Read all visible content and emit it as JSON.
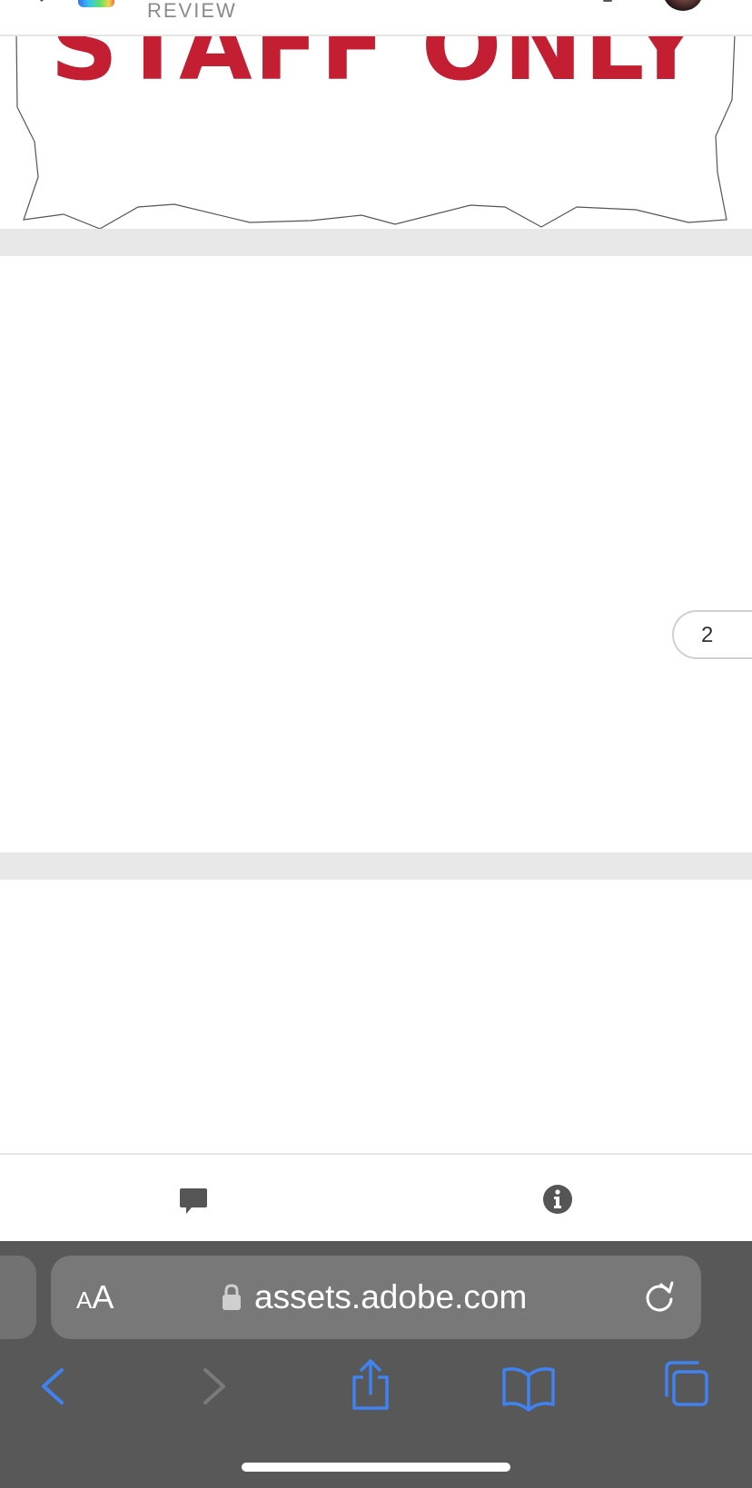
{
  "header": {
    "subtitle": "REVIEW"
  },
  "document": {
    "page1_heading": "STAFF ONLY",
    "page2_number": "2"
  },
  "action_bar": {
    "comment_icon": "comment-icon",
    "info_icon": "info-icon"
  },
  "browser": {
    "text_size_label_small": "A",
    "text_size_label_large": "A",
    "url": "assets.adobe.com",
    "icons": [
      "lock-icon",
      "reload-icon",
      "back-icon",
      "forward-icon",
      "share-icon",
      "bookmarks-icon",
      "tabs-icon"
    ]
  },
  "colors": {
    "sign_red": "#c41e32",
    "safari_blue": "#3f83f3",
    "toolbar_bg": "#585858"
  }
}
